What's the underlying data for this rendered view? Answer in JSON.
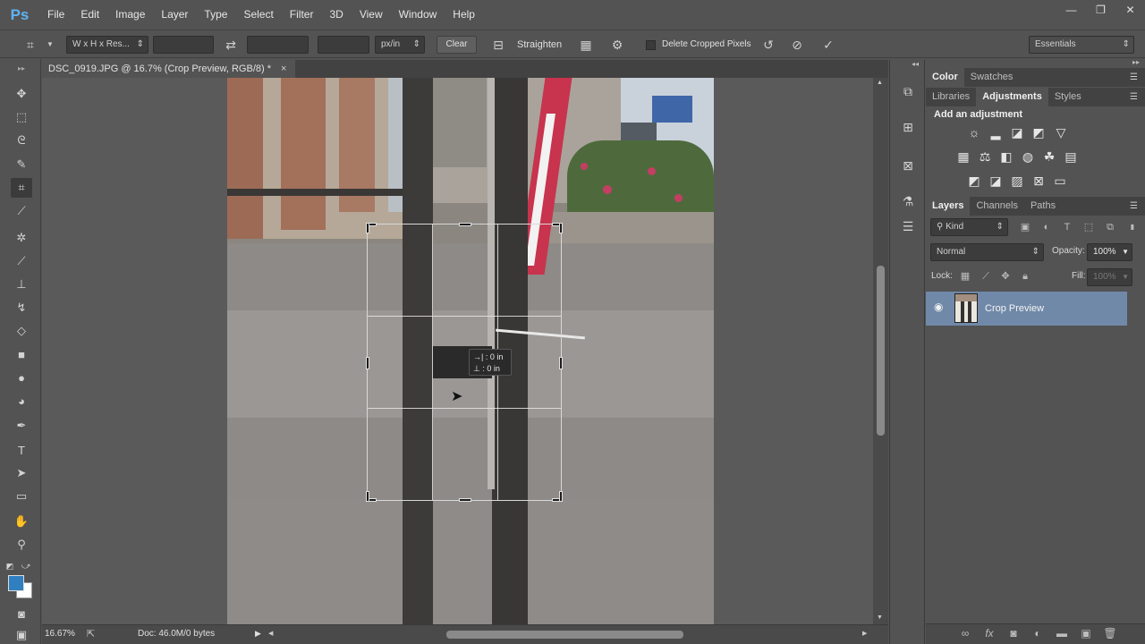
{
  "app": {
    "logo": "Ps"
  },
  "menu": [
    "File",
    "Edit",
    "Image",
    "Layer",
    "Type",
    "Select",
    "Filter",
    "3D",
    "View",
    "Window",
    "Help"
  ],
  "window_controls": {
    "minimize": "—",
    "restore": "❐",
    "close": "✕"
  },
  "options_bar": {
    "ratio_preset": "W x H x Res...",
    "unit": "px/in",
    "clear_label": "Clear",
    "straighten_label": "Straighten",
    "delete_cropped_label": "Delete Cropped Pixels",
    "workspace": "Essentials"
  },
  "document": {
    "tab_title": "DSC_0919.JPG @ 16.7% (Crop Preview, RGB/8) *",
    "close_glyph": "×",
    "zoom": "16.67%",
    "doc_info": "Doc: 46.0M/0 bytes"
  },
  "crop_tooltip": {
    "dx": "→| : 0 in",
    "dy": "⊥ : 0 in"
  },
  "panels": {
    "top_tabs": [
      "Color",
      "Swatches"
    ],
    "adj_tabs": [
      "Libraries",
      "Adjustments",
      "Styles"
    ],
    "adjustments_title": "Add an adjustment",
    "layer_tabs": [
      "Layers",
      "Channels",
      "Paths"
    ],
    "layers": {
      "kind_filter": "Kind",
      "blend_mode": "Normal",
      "opacity_label": "Opacity:",
      "opacity_value": "100%",
      "lock_label": "Lock:",
      "fill_label": "Fill:",
      "fill_value": "100%",
      "items": [
        {
          "name": "Crop Preview",
          "visible": true,
          "selected": true
        }
      ]
    }
  }
}
